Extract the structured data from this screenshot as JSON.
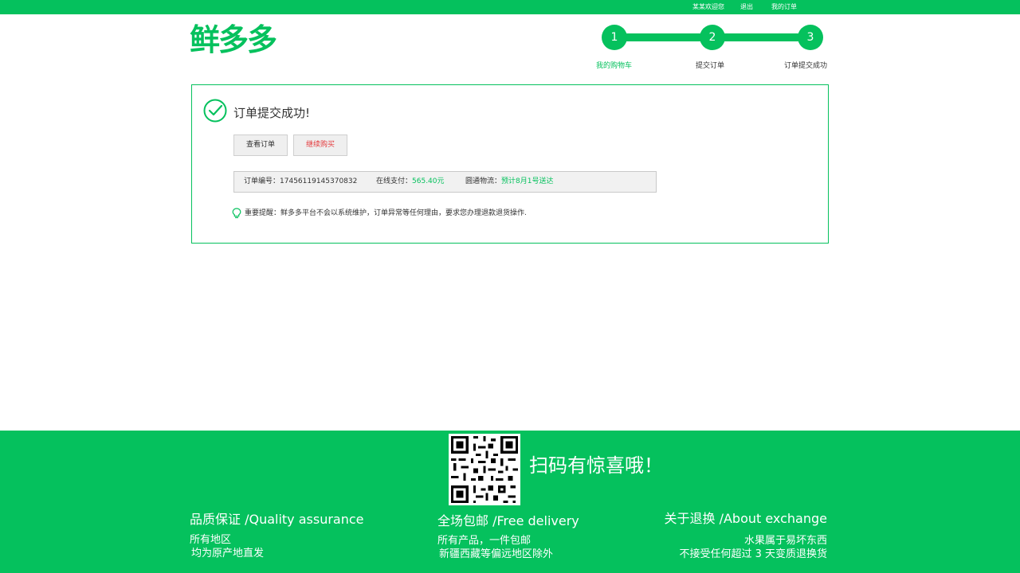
{
  "colors": {
    "brand": "#05c15d",
    "alert": "#e4393c"
  },
  "topbar": {
    "welcome": "某某欢迎您",
    "logout": "退出",
    "my_orders": "我的订单"
  },
  "logo": {
    "text": "鲜多多"
  },
  "steps": [
    {
      "number": "1",
      "label": "我的购物车"
    },
    {
      "number": "2",
      "label": "提交订单"
    },
    {
      "number": "3",
      "label": "订单提交成功"
    }
  ],
  "result": {
    "title": "订单提交成功!",
    "view_order_label": "查看订单",
    "continue_label": "继续购买",
    "order_no_label": "订单编号：",
    "order_no": "17456119145370832",
    "payment_label": "在线支付：",
    "payment_value": "565.40元",
    "logistics_label": "圆通物流：",
    "logistics_value": "预计8月1号送达",
    "notice_label": "重要提醒：",
    "notice_text": "鲜多多平台不会以系统维护，订单异常等任何理由，要求您办理退款退货操作."
  },
  "footer": {
    "qr_icon": "qr-code-icon",
    "scan_text": "扫码有惊喜哦！",
    "col1": {
      "title": "品质保证 /Quality assurance",
      "line1": "所有地区",
      "line2": "均为原产地直发"
    },
    "col2": {
      "title": "全场包邮 /Free delivery",
      "line1": "所有产品，一件包邮",
      "line2": "新疆西藏等偏远地区除外"
    },
    "col3": {
      "title": "关于退换 /About exchange",
      "line1": "水果属于易坏东西",
      "line2": "不接受任何超过 3 天变质退换货"
    }
  }
}
